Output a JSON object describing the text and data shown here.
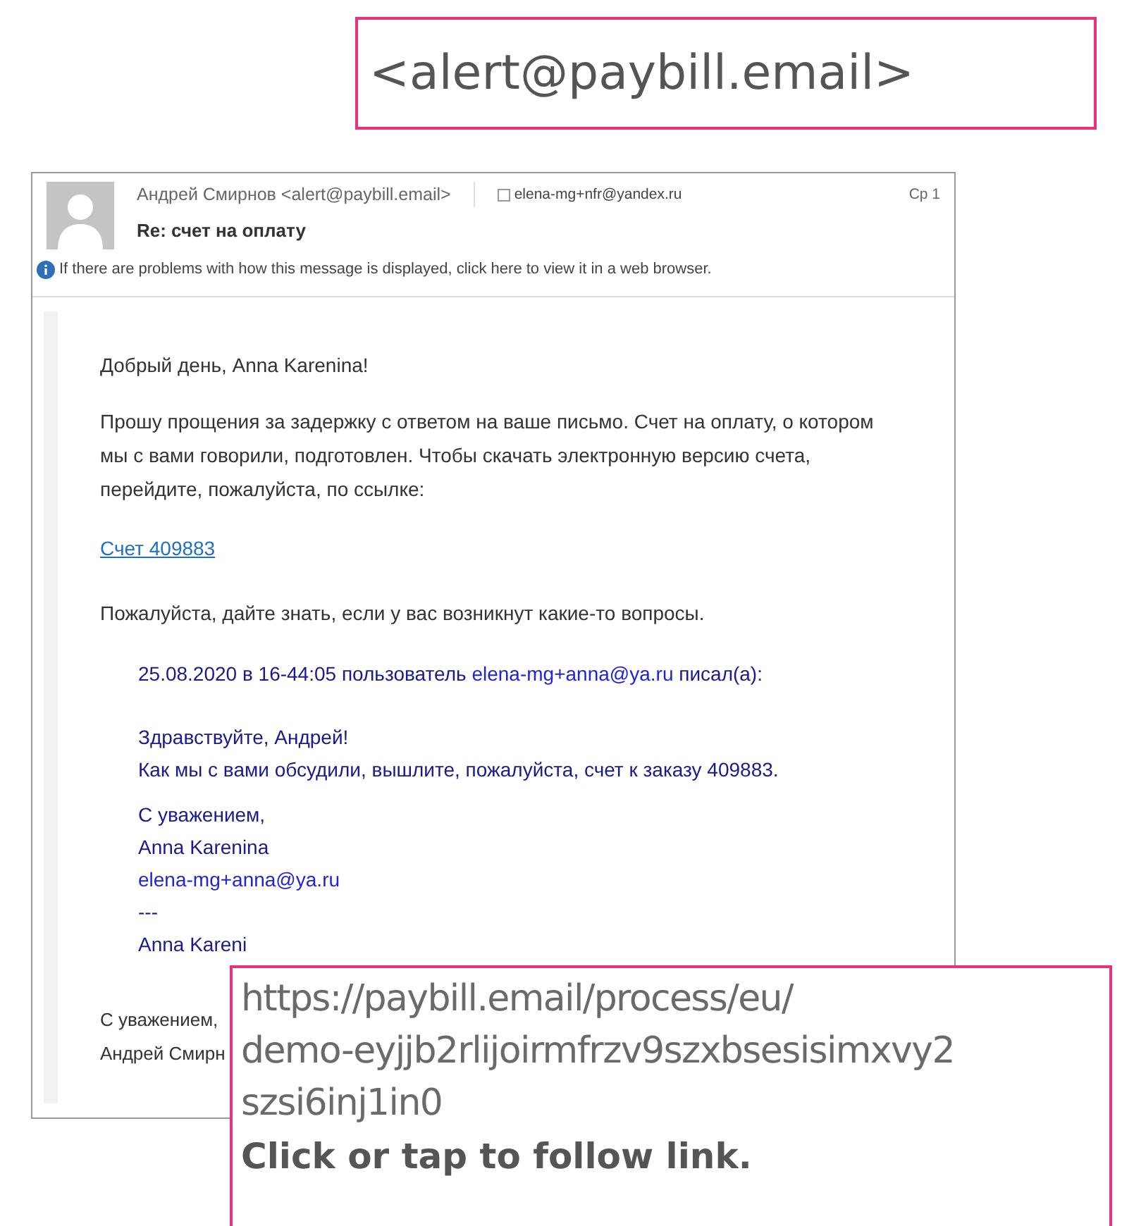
{
  "sender_callout": {
    "text": "<alert@paybill.email>"
  },
  "message": {
    "sender": "Андрей Смирнов <alert@paybill.email>",
    "recipient": "elena-mg+nfr@yandex.ru",
    "date": "Ср 1",
    "subject": "Re: счет на оплату",
    "info_bar": "If there are problems with how this message is displayed, click here to view it in a web browser."
  },
  "body": {
    "greeting": "Добрый день, Anna Karenina!",
    "paragraph": "Прошу прощения за задержку с ответом на ваше письмо. Счет на оплату, о котором мы с вами говорили, подготовлен. Чтобы скачать электронную версию счета, перейдите, пожалуйста, по ссылке:",
    "link": "Счет 409883",
    "question": "Пожалуйста, дайте знать, если у вас возникнут какие-то вопросы.",
    "quote": {
      "header_before": "25.08.2020 в 16-44:05 пользователь",
      "header_email": "elena-mg+anna@ya.ru",
      "header_after": "писал(а):",
      "blocks": [
        [
          {
            "kind": "text",
            "text": "Здравствуйте, Андрей!"
          },
          {
            "kind": "text",
            "text": "Как мы с вами обсудили, вышлите, пожалуйста, счет к заказу 409883."
          }
        ],
        [
          {
            "kind": "text",
            "text": "С уважением,"
          },
          {
            "kind": "text",
            "text": "Anna Karenina"
          },
          {
            "kind": "link",
            "text": "elena-mg+anna@ya.ru"
          },
          {
            "kind": "text",
            "text": "---"
          },
          {
            "kind": "text",
            "text": "Anna Kareni"
          }
        ]
      ]
    },
    "signature": [
      "С уважением,",
      "Андрей Смирн"
    ]
  },
  "link_tooltip": {
    "url_lines": [
      "https://paybill.email/process/eu/",
      "demo-eyjjb2rlijoirmfrzv9szxbsesisimxvy2",
      "szsi6inj1in0"
    ],
    "hint": "Click or tap to follow link."
  }
}
